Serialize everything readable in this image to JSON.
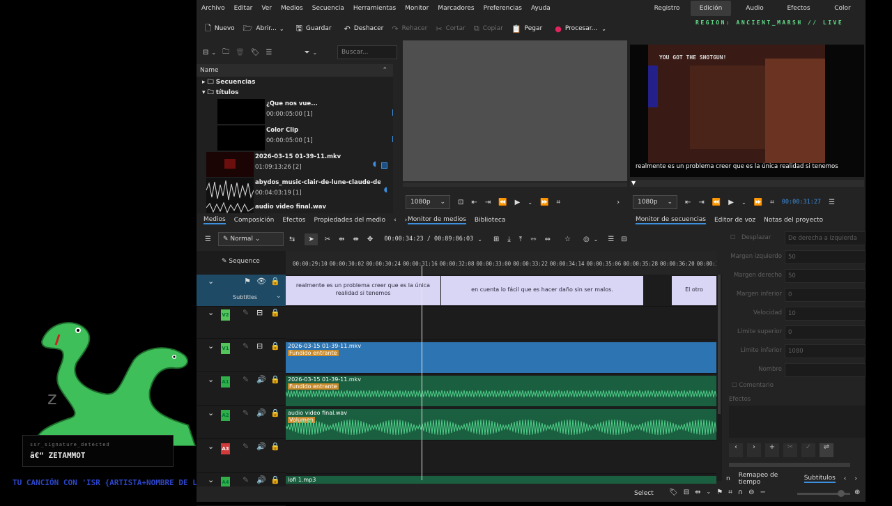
{
  "menu": [
    "Archivo",
    "Editar",
    "Ver",
    "Medios",
    "Secuencia",
    "Herramientas",
    "Monitor",
    "Marcadores",
    "Preferencias",
    "Ayuda"
  ],
  "workspaces": [
    "Registro",
    "Edición",
    "Audio",
    "Efectos",
    "Color"
  ],
  "active_workspace": "Edición",
  "toolbar": {
    "nuevo": "Nuevo",
    "abrir": "Abrir...",
    "guardar": "Guardar",
    "deshacer": "Deshacer",
    "rehacer": "Rehacer",
    "cortar": "Cortar",
    "copiar": "Copiar",
    "pegar": "Pegar",
    "procesar": "Procesar..."
  },
  "overlay": {
    "region": "REGION: ANCIENT_MARSH // LIVE",
    "signature_label": "ssr_signature_detected",
    "signature_value": "â€“ ZETAMMOT",
    "ticker": "TU CANCIÓN CON 'ISR {ARTISTA+NOMBRE DE LA CANCIÓN}'"
  },
  "bin": {
    "search_placeholder": "Buscar...",
    "header": "Name",
    "folders": [
      "Secuencias",
      "títulos"
    ],
    "clips": [
      {
        "name": "¿Que nos vue...",
        "duration": "00:00:05:00 [1]"
      },
      {
        "name": "Color Clip",
        "duration": "00:00:05:00 [1]"
      },
      {
        "name": "2026-03-15 01-39-11.mkv",
        "duration": "01:09:13:26 [2]"
      },
      {
        "name": "abydos_music-clair-de-lune-claude-debussy-mo",
        "duration": "00:04:03:19 [1]"
      },
      {
        "name": "audio video final.wav",
        "duration": ""
      }
    ],
    "tabs": [
      "Medios",
      "Composición",
      "Efectos",
      "Propiedades del medio"
    ]
  },
  "clip_monitor": {
    "resolution": "1080p",
    "tabs": [
      "Monitor de medios",
      "Biblioteca"
    ]
  },
  "project_monitor": {
    "game_text": "YOU GOT THE SHOTGUN!",
    "subtitle": "realmente es un problema creer que es la única realidad si tenemos",
    "resolution": "1080p",
    "timecode": "00:00:31:27",
    "tabs": [
      "Monitor de secuencias",
      "Editor de voz",
      "Notas del proyecto"
    ]
  },
  "timeline": {
    "mode": "Normal",
    "timecode": "00:00:34:23 / 00:89:86:03",
    "sequence_label": "Sequence",
    "ticks": [
      "00:00:29:10",
      "00:00:30:02",
      "00:00:30:24",
      "00:00:31:16",
      "00:00:32:08",
      "00:00:33:00",
      "00:00:33:22",
      "00:00:34:14",
      "00:00:35:06",
      "00:00:35:28",
      "00:00:36:20",
      "00:00:37:1"
    ],
    "subtitles_label": "Subtitles",
    "subtitle_clips": [
      "realmente es un problema creer que es la única realidad si tenemos",
      "en cuenta lo fácil que es hacer daño sin ser malos.",
      "El otro"
    ],
    "tracks": [
      {
        "tag": "V2",
        "clip": "",
        "effect": ""
      },
      {
        "tag": "V1",
        "clip": "2026-03-15 01-39-11.mkv",
        "effect": "Fundido entrante"
      },
      {
        "tag": "A1",
        "clip": "2026-03-15 01-39-11.mkv",
        "effect": "Fundido entrante"
      },
      {
        "tag": "A2",
        "clip": "audio video final.wav",
        "effect": "Volumen"
      },
      {
        "tag": "A3",
        "clip": "",
        "effect": ""
      },
      {
        "tag": "A4",
        "clip": "lofi 1.mp3",
        "effect": ""
      }
    ]
  },
  "properties": {
    "desplazar": "Desplazar",
    "desplazar_value": "De derecha a izquierda",
    "rows": [
      {
        "label": "Margen izquierdo",
        "value": "50"
      },
      {
        "label": "Margen derecho",
        "value": "50"
      },
      {
        "label": "Margen inferior",
        "value": "0"
      },
      {
        "label": "Velocidad",
        "value": "10"
      },
      {
        "label": "Límite superior",
        "value": "0"
      },
      {
        "label": "Límite inferior",
        "value": "1080"
      },
      {
        "label": "Nombre",
        "value": ""
      }
    ],
    "comentario": "Comentario",
    "efectos": "Efectos",
    "tabs": [
      "n",
      "Remapeo de tiempo",
      "Subtitulos"
    ]
  },
  "status": {
    "select": "Select"
  }
}
